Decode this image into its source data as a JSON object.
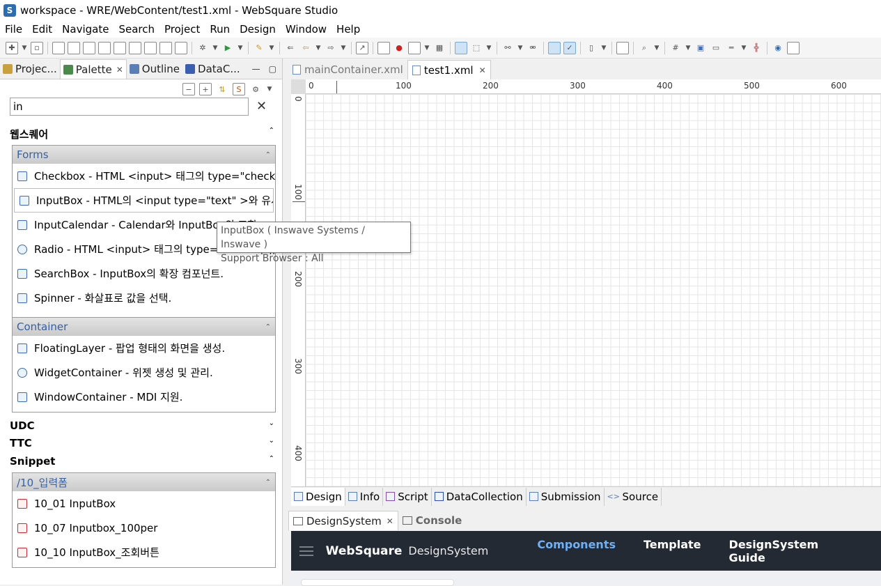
{
  "window": {
    "title": "workspace - WRE/WebContent/test1.xml - WebSquare Studio",
    "icon": "ws-app-icon"
  },
  "menu": [
    "File",
    "Edit",
    "Navigate",
    "Search",
    "Project",
    "Run",
    "Design",
    "Window",
    "Help"
  ],
  "left_tabs": [
    {
      "label": "Projec...",
      "active": false
    },
    {
      "label": "Palette",
      "active": true
    },
    {
      "label": "Outline",
      "active": false
    },
    {
      "label": "DataC...",
      "active": false
    }
  ],
  "palette": {
    "search_value": "in",
    "drawer_websquare": "웹스퀘어",
    "forms_header": "Forms",
    "forms_items": [
      "Checkbox - HTML <input> 태그의 type=\"checkbo",
      "InputBox - HTML의 <input type=\"text\" >와 유사.",
      "InputCalendar - Calendar와 InputBox의 조합.",
      "Radio - HTML <input> 태그의 type=\"radio\"와 유",
      "SearchBox - InputBox의 확장 컴포넌트.",
      "Spinner - 화살표로 값을 선택."
    ],
    "container_header": "Container",
    "container_items": [
      "FloatingLayer - 팝업 형태의 화면을 생성.",
      "WidgetContainer - 위젯 생성 및 관리.",
      "WindowContainer - MDI 지원."
    ],
    "drawer_udc": "UDC",
    "drawer_ttc": "TTC",
    "drawer_snippet": "Snippet",
    "snippet_header": "/10_입력폼",
    "snippet_items": [
      "10_01 InputBox",
      "10_07 Inputbox_100per",
      "10_10 InputBox_조회버튼"
    ]
  },
  "tooltip": {
    "line1": "InputBox ( Inswave Systems / Inswave )",
    "line2": "Support Browser : All"
  },
  "editor_tabs": [
    {
      "label": "mainContainer.xml",
      "active": false
    },
    {
      "label": "test1.xml",
      "active": true
    }
  ],
  "ruler": {
    "h_labels": [
      "0",
      "100",
      "200",
      "300",
      "400",
      "500",
      "600"
    ],
    "v_labels": [
      "0",
      "100",
      "200",
      "300",
      "400"
    ]
  },
  "bottom_tabs": [
    "Design",
    "Info",
    "Script",
    "DataCollection",
    "Submission",
    "Source"
  ],
  "lower_tabs": [
    {
      "label": "DesignSystem",
      "active": true
    },
    {
      "label": "Console",
      "active": false
    }
  ],
  "designsystem": {
    "brand": "WebSquare",
    "sub": "DesignSystem",
    "nav": [
      "Components",
      "Template",
      "DesignSystem Guide"
    ],
    "active_color": "#6fb0f5"
  }
}
